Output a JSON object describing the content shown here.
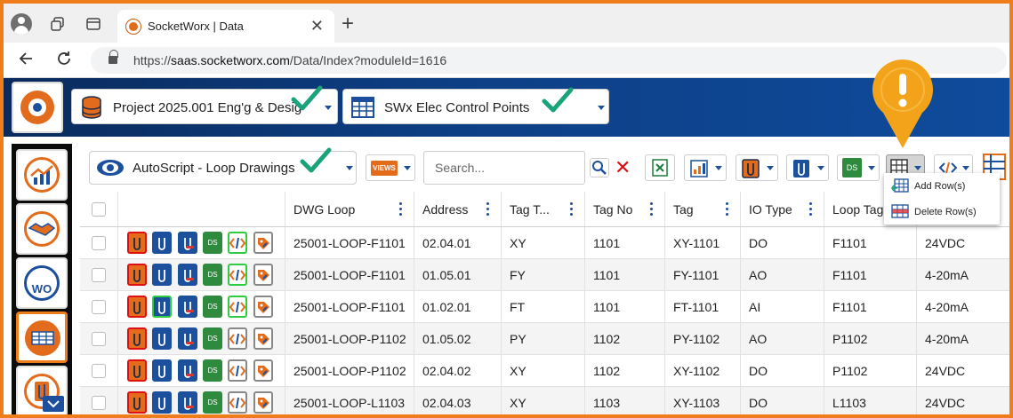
{
  "browser": {
    "tab_title": "SocketWorx | Data",
    "url_prefix": "https://",
    "url_host": "saas.socketworx.com",
    "url_path": "/Data/Index?moduleId=1616",
    "close_glyph": "✕",
    "newtab_glyph": "+"
  },
  "header": {
    "project_select": "Project 2025.001 Eng'g & Desig...",
    "module_select": "SWx Elec Control Points"
  },
  "sidebar": {
    "wo_label": "WO"
  },
  "toolbar": {
    "view_select": "AutoScript - Loop Drawings",
    "views_label": "VIEWS",
    "search_placeholder": "Search...",
    "ds_label": "DS"
  },
  "menu": {
    "add_rows": "Add Row(s)",
    "delete_rows": "Delete Row(s)"
  },
  "table": {
    "columns": [
      "",
      "",
      "DWG Loop",
      "Address",
      "Tag T...",
      "Tag No",
      "Tag",
      "IO Type",
      "Loop Tag",
      ""
    ],
    "rows": [
      [
        "25001-LOOP-F1101",
        "02.04.01",
        "XY",
        "1101",
        "XY-1101",
        "DO",
        "F1101",
        "24VDC"
      ],
      [
        "25001-LOOP-F1101",
        "01.05.01",
        "FY",
        "1101",
        "FY-1101",
        "AO",
        "F1101",
        "4-20mA"
      ],
      [
        "25001-LOOP-F1101",
        "01.02.01",
        "FT",
        "1101",
        "FT-1101",
        "AI",
        "F1101",
        "4-20mA"
      ],
      [
        "25001-LOOP-P1102",
        "01.05.02",
        "PY",
        "1102",
        "PY-1102",
        "AO",
        "P1102",
        "4-20mA"
      ],
      [
        "25001-LOOP-P1102",
        "02.04.02",
        "XY",
        "1102",
        "XY-1102",
        "DO",
        "P1102",
        "24VDC"
      ],
      [
        "25001-LOOP-L1103",
        "02.04.03",
        "XY",
        "1103",
        "XY-1103",
        "DO",
        "L1103",
        "24VDC"
      ]
    ]
  },
  "colors": {
    "accent_orange": "#ef7d1a",
    "brand_blue": "#1c4f9c",
    "check_green": "#1aa37a",
    "pin_amber": "#f2a319"
  }
}
